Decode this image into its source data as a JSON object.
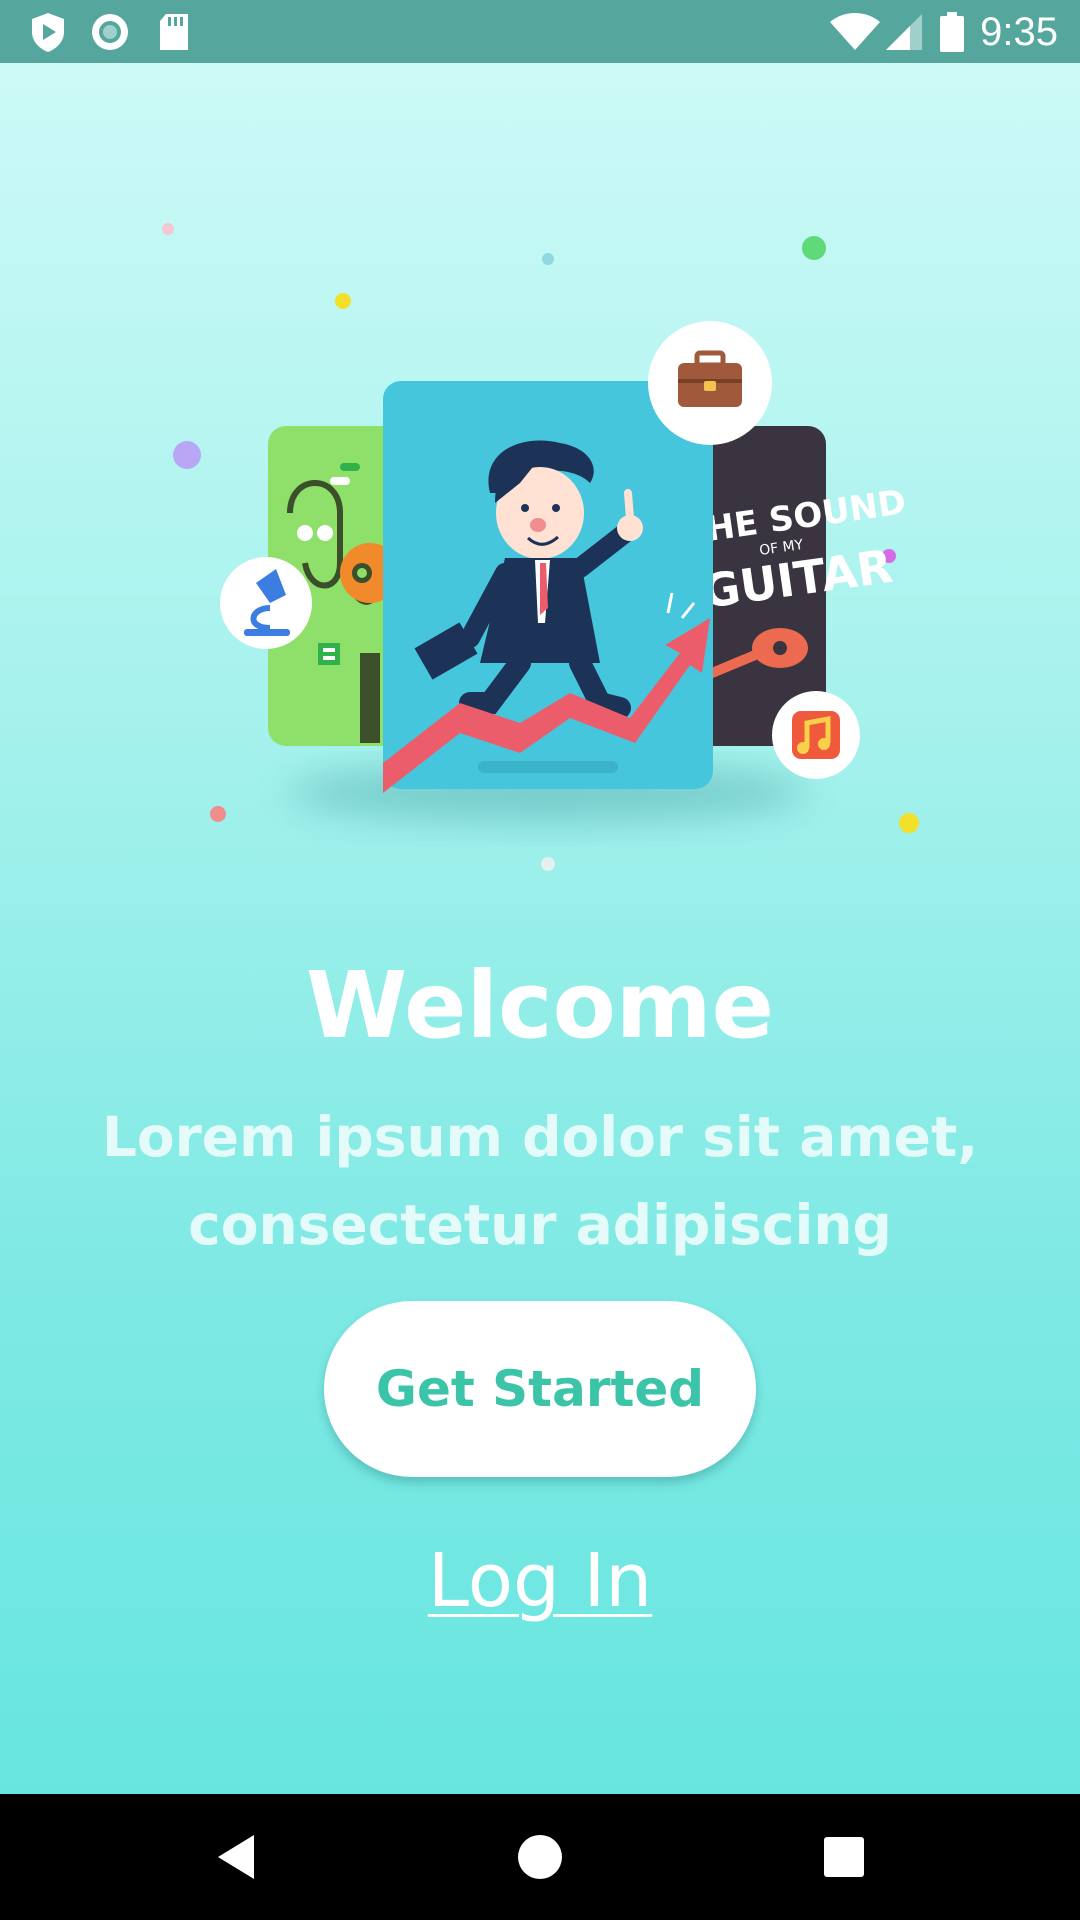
{
  "status_bar": {
    "time": "9:35",
    "left_icons": [
      "play-shield-icon",
      "circle-record-icon",
      "sd-card-icon"
    ],
    "right_icons": [
      "wifi-icon",
      "cell-signal-icon",
      "battery-icon"
    ],
    "background": "#55a69c"
  },
  "illustration": {
    "guitar_card_text": [
      "HE SOUND",
      "OF MY",
      "GUITAR"
    ],
    "badges": [
      "briefcase-icon",
      "microscope-icon",
      "music-note-icon"
    ]
  },
  "welcome": {
    "title": "Welcome",
    "subtitle_line1": "Lorem ipsum dolor sit amet,",
    "subtitle_line2": "consectetur adipiscing"
  },
  "actions": {
    "get_started_label": "Get Started",
    "login_label": "Log In"
  },
  "nav_bar": {
    "buttons": [
      "back-icon",
      "home-icon",
      "recents-icon"
    ]
  },
  "colors": {
    "accent": "#3cc4a8",
    "background_top": "#cdfaf7",
    "background_bottom": "#67e6e0",
    "card_blue": "#45c6dc",
    "card_green": "#8ee06a",
    "card_dark": "#3a3440",
    "arrow_red": "#ec5d6b"
  }
}
